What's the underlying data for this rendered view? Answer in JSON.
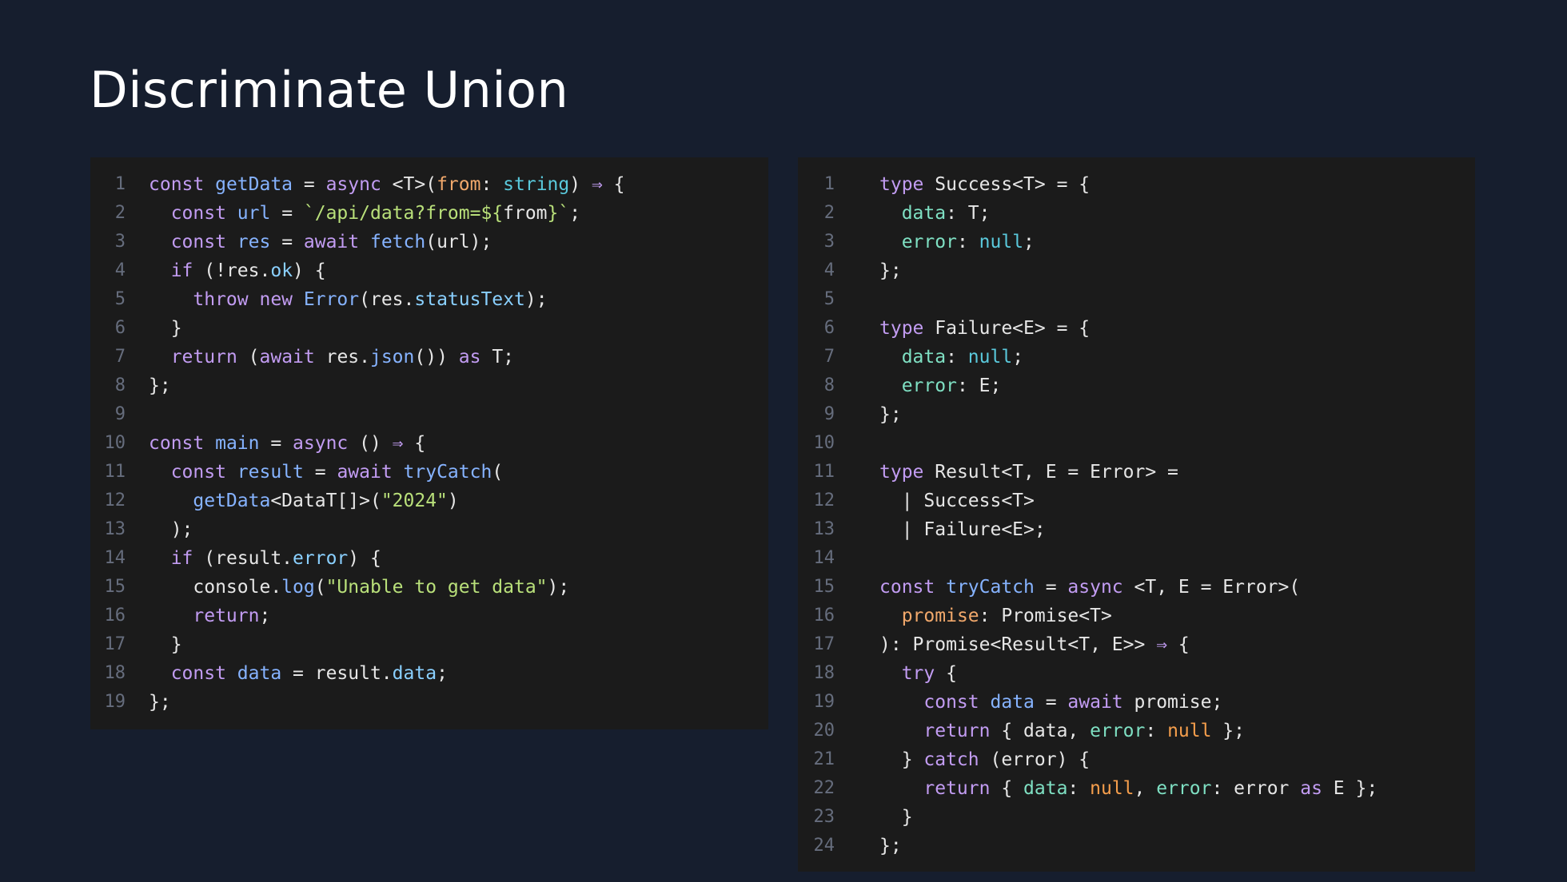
{
  "slide": {
    "title": "Discriminate Union"
  },
  "colors": {
    "background": "#161e2e",
    "panel": "#1b1b1b",
    "line_number": "#666d7d",
    "kw": "#c29cf2",
    "var": "#86b3ff",
    "prop": "#8ad0ff",
    "type": "#5ac9dc",
    "str": "#b9e07a",
    "param": "#f1a86b",
    "text": "#e6e6e6",
    "field": "#7fe0c3",
    "null_left": "#40c4d0",
    "null_orange": "#f59e4c"
  },
  "left_code": {
    "lines": [
      {
        "n": "1",
        "tokens": [
          [
            "kw",
            "const "
          ],
          [
            "var",
            "getData"
          ],
          [
            "text",
            " = "
          ],
          [
            "kw",
            "async "
          ],
          [
            "text",
            "<T>("
          ],
          [
            "param",
            "from"
          ],
          [
            "text",
            ": "
          ],
          [
            "type",
            "string"
          ],
          [
            "text",
            ") "
          ],
          [
            "kw",
            "⇒"
          ],
          [
            "text",
            " {"
          ]
        ]
      },
      {
        "n": "2",
        "tokens": [
          [
            "text",
            "  "
          ],
          [
            "kw",
            "const "
          ],
          [
            "var",
            "url"
          ],
          [
            "text",
            " = "
          ],
          [
            "str",
            "`/api/data?from=${"
          ],
          [
            "text",
            "from"
          ],
          [
            "str",
            "}`"
          ],
          [
            "text",
            ";"
          ]
        ]
      },
      {
        "n": "3",
        "tokens": [
          [
            "text",
            "  "
          ],
          [
            "kw",
            "const "
          ],
          [
            "var",
            "res"
          ],
          [
            "text",
            " = "
          ],
          [
            "kw",
            "await "
          ],
          [
            "var",
            "fetch"
          ],
          [
            "text",
            "(url);"
          ]
        ]
      },
      {
        "n": "4",
        "tokens": [
          [
            "text",
            "  "
          ],
          [
            "kw",
            "if "
          ],
          [
            "text",
            "(!res."
          ],
          [
            "prop",
            "ok"
          ],
          [
            "text",
            ") {"
          ]
        ]
      },
      {
        "n": "5",
        "tokens": [
          [
            "text",
            "    "
          ],
          [
            "kw",
            "throw "
          ],
          [
            "kw",
            "new "
          ],
          [
            "var",
            "Error"
          ],
          [
            "text",
            "(res."
          ],
          [
            "prop",
            "statusText"
          ],
          [
            "text",
            ");"
          ]
        ]
      },
      {
        "n": "6",
        "tokens": [
          [
            "text",
            "  }"
          ]
        ]
      },
      {
        "n": "7",
        "tokens": [
          [
            "text",
            "  "
          ],
          [
            "kw",
            "return "
          ],
          [
            "text",
            "("
          ],
          [
            "kw",
            "await "
          ],
          [
            "text",
            "res."
          ],
          [
            "var",
            "json"
          ],
          [
            "text",
            "()) "
          ],
          [
            "kw",
            "as "
          ],
          [
            "text",
            "T;"
          ]
        ]
      },
      {
        "n": "8",
        "tokens": [
          [
            "text",
            "};"
          ]
        ]
      },
      {
        "n": "9",
        "tokens": [
          [
            "text",
            ""
          ]
        ]
      },
      {
        "n": "10",
        "tokens": [
          [
            "kw",
            "const "
          ],
          [
            "var",
            "main"
          ],
          [
            "text",
            " = "
          ],
          [
            "kw",
            "async "
          ],
          [
            "text",
            "() "
          ],
          [
            "kw",
            "⇒"
          ],
          [
            "text",
            " {"
          ]
        ]
      },
      {
        "n": "11",
        "tokens": [
          [
            "text",
            "  "
          ],
          [
            "kw",
            "const "
          ],
          [
            "var",
            "result"
          ],
          [
            "text",
            " = "
          ],
          [
            "kw",
            "await "
          ],
          [
            "var",
            "tryCatch"
          ],
          [
            "text",
            "("
          ]
        ]
      },
      {
        "n": "12",
        "tokens": [
          [
            "text",
            "    "
          ],
          [
            "var",
            "getData"
          ],
          [
            "text",
            "<DataT[]>("
          ],
          [
            "str",
            "\"2024\""
          ],
          [
            "text",
            ")"
          ]
        ]
      },
      {
        "n": "13",
        "tokens": [
          [
            "text",
            "  );"
          ]
        ]
      },
      {
        "n": "14",
        "tokens": [
          [
            "text",
            "  "
          ],
          [
            "kw",
            "if "
          ],
          [
            "text",
            "(result."
          ],
          [
            "prop",
            "error"
          ],
          [
            "text",
            ") {"
          ]
        ]
      },
      {
        "n": "15",
        "tokens": [
          [
            "text",
            "    console."
          ],
          [
            "var",
            "log"
          ],
          [
            "text",
            "("
          ],
          [
            "str",
            "\"Unable to get data\""
          ],
          [
            "text",
            ");"
          ]
        ]
      },
      {
        "n": "16",
        "tokens": [
          [
            "text",
            "    "
          ],
          [
            "kw",
            "return"
          ],
          [
            "text",
            ";"
          ]
        ]
      },
      {
        "n": "17",
        "tokens": [
          [
            "text",
            "  }"
          ]
        ]
      },
      {
        "n": "18",
        "tokens": [
          [
            "text",
            "  "
          ],
          [
            "kw",
            "const "
          ],
          [
            "var",
            "data"
          ],
          [
            "text",
            " = result."
          ],
          [
            "prop",
            "data"
          ],
          [
            "text",
            ";"
          ]
        ]
      },
      {
        "n": "19",
        "tokens": [
          [
            "text",
            "};"
          ]
        ]
      }
    ]
  },
  "right_code": {
    "lines": [
      {
        "n": "1",
        "tokens": [
          [
            "kw",
            "type "
          ],
          [
            "text",
            "Success<T> = {"
          ]
        ]
      },
      {
        "n": "2",
        "tokens": [
          [
            "text",
            "  "
          ],
          [
            "field",
            "data"
          ],
          [
            "text",
            ": T;"
          ]
        ]
      },
      {
        "n": "3",
        "tokens": [
          [
            "text",
            "  "
          ],
          [
            "field",
            "error"
          ],
          [
            "text",
            ": "
          ],
          [
            "type",
            "null"
          ],
          [
            "text",
            ";"
          ]
        ]
      },
      {
        "n": "4",
        "tokens": [
          [
            "text",
            "};"
          ]
        ]
      },
      {
        "n": "5",
        "tokens": [
          [
            "text",
            ""
          ]
        ]
      },
      {
        "n": "6",
        "tokens": [
          [
            "kw",
            "type "
          ],
          [
            "text",
            "Failure<E> = {"
          ]
        ]
      },
      {
        "n": "7",
        "tokens": [
          [
            "text",
            "  "
          ],
          [
            "field",
            "data"
          ],
          [
            "text",
            ": "
          ],
          [
            "type",
            "null"
          ],
          [
            "text",
            ";"
          ]
        ]
      },
      {
        "n": "8",
        "tokens": [
          [
            "text",
            "  "
          ],
          [
            "field",
            "error"
          ],
          [
            "text",
            ": E;"
          ]
        ]
      },
      {
        "n": "9",
        "tokens": [
          [
            "text",
            "};"
          ]
        ]
      },
      {
        "n": "10",
        "tokens": [
          [
            "text",
            ""
          ]
        ]
      },
      {
        "n": "11",
        "tokens": [
          [
            "kw",
            "type "
          ],
          [
            "text",
            "Result<T, E = Error> ="
          ]
        ]
      },
      {
        "n": "12",
        "tokens": [
          [
            "text",
            "  | Success<T>"
          ]
        ]
      },
      {
        "n": "13",
        "tokens": [
          [
            "text",
            "  | Failure<E>;"
          ]
        ]
      },
      {
        "n": "14",
        "tokens": [
          [
            "text",
            ""
          ]
        ]
      },
      {
        "n": "15",
        "tokens": [
          [
            "kw",
            "const "
          ],
          [
            "var",
            "tryCatch"
          ],
          [
            "text",
            " = "
          ],
          [
            "kw",
            "async "
          ],
          [
            "text",
            "<T, E = Error>("
          ]
        ]
      },
      {
        "n": "16",
        "tokens": [
          [
            "text",
            "  "
          ],
          [
            "param",
            "promise"
          ],
          [
            "text",
            ": Promise<T>"
          ]
        ]
      },
      {
        "n": "17",
        "tokens": [
          [
            "text",
            "): Promise<Result<T, E>> "
          ],
          [
            "kw",
            "⇒"
          ],
          [
            "text",
            " {"
          ]
        ]
      },
      {
        "n": "18",
        "tokens": [
          [
            "text",
            "  "
          ],
          [
            "kw",
            "try "
          ],
          [
            "text",
            "{"
          ]
        ]
      },
      {
        "n": "19",
        "tokens": [
          [
            "text",
            "    "
          ],
          [
            "kw",
            "const "
          ],
          [
            "var",
            "data"
          ],
          [
            "text",
            " = "
          ],
          [
            "kw",
            "await "
          ],
          [
            "text",
            "promise;"
          ]
        ]
      },
      {
        "n": "20",
        "tokens": [
          [
            "text",
            "    "
          ],
          [
            "kw",
            "return "
          ],
          [
            "text",
            "{ data, "
          ],
          [
            "field",
            "error"
          ],
          [
            "text",
            ": "
          ],
          [
            "null_orange",
            "null"
          ],
          [
            "text",
            " };"
          ]
        ]
      },
      {
        "n": "21",
        "tokens": [
          [
            "text",
            "  } "
          ],
          [
            "kw",
            "catch "
          ],
          [
            "text",
            "(error) {"
          ]
        ]
      },
      {
        "n": "22",
        "tokens": [
          [
            "text",
            "    "
          ],
          [
            "kw",
            "return "
          ],
          [
            "text",
            "{ "
          ],
          [
            "field",
            "data"
          ],
          [
            "text",
            ": "
          ],
          [
            "null_orange",
            "null"
          ],
          [
            "text",
            ", "
          ],
          [
            "field",
            "error"
          ],
          [
            "text",
            ": error "
          ],
          [
            "kw",
            "as "
          ],
          [
            "text",
            "E };"
          ]
        ]
      },
      {
        "n": "23",
        "tokens": [
          [
            "text",
            "  }"
          ]
        ]
      },
      {
        "n": "24",
        "tokens": [
          [
            "text",
            "};"
          ]
        ]
      }
    ]
  }
}
